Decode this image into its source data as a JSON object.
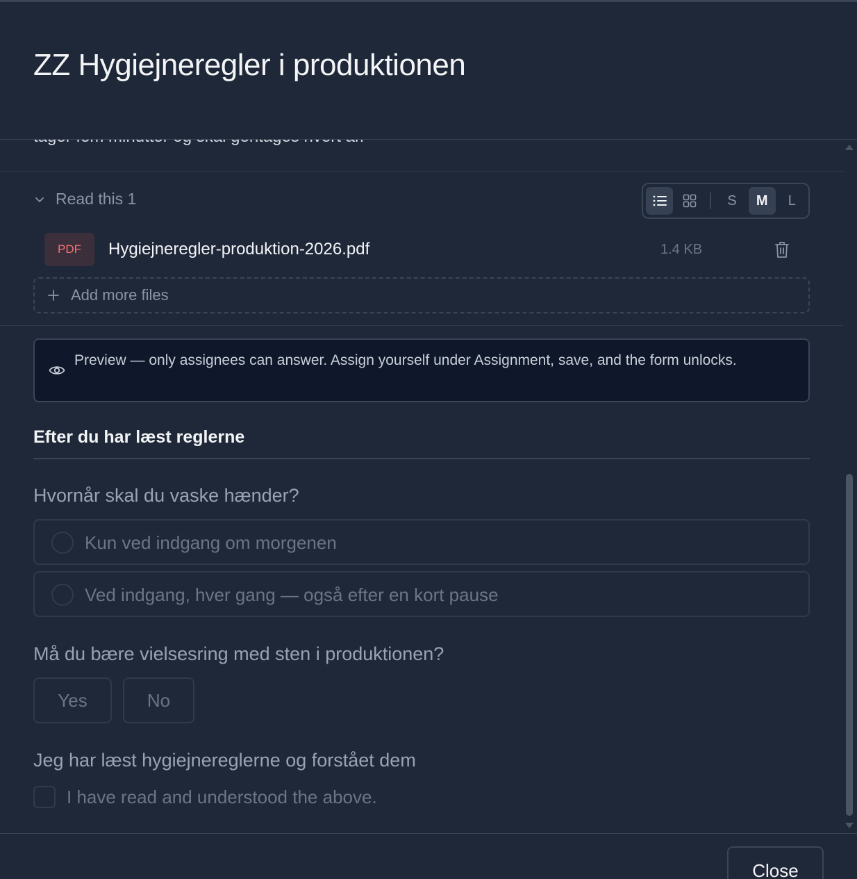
{
  "modal": {
    "title": "ZZ Hygiejneregler i produktionen",
    "cut_text": "tager fem minutter og skal gentages hvert år."
  },
  "files_section": {
    "toggle_label": "Read this 1",
    "view_toolbar": {
      "list_icon": "list-icon",
      "grid_icon": "grid-icon",
      "sizes": [
        "S",
        "M",
        "L"
      ],
      "active_view": "list",
      "active_size": "M"
    },
    "file": {
      "badge": "PDF",
      "name": "Hygiejneregler-produktion-2026.pdf",
      "size": "1.4 KB",
      "delete_icon": "trash-icon"
    },
    "add_more_label": "Add more files"
  },
  "preview_notice": {
    "icon": "eye-icon",
    "text": "Preview — only assignees can answer. Assign yourself under Assignment, save, and the form unlocks."
  },
  "form": {
    "heading": "Efter du har læst reglerne",
    "questions": [
      {
        "label": "Hvornår skal du vaske hænder?",
        "options": [
          "Kun ved indgang om morgenen",
          "Ved indgang, hver gang — også efter en kort pause"
        ]
      },
      {
        "label": "Må du bære vielsesring med sten i produktionen?",
        "options": [
          "Yes",
          "No"
        ]
      },
      {
        "label": "Jeg har læst hygiejnereglerne og forstået dem",
        "checkbox_label": "I have read and understood the above."
      }
    ]
  },
  "footer": {
    "close_label": "Close"
  },
  "colors": {
    "background": "#1f2839",
    "notice_background": "#0f172a",
    "pdf_badge_text": "#f87171",
    "border": "#3a4557"
  }
}
